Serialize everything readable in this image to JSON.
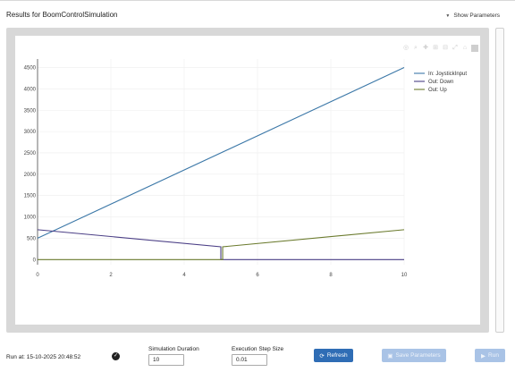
{
  "header": {
    "title": "Results for BoomControlSimulation",
    "show_parameters": "Show Parameters"
  },
  "toolbar_icons": [
    "camera-icon",
    "zoom-icon",
    "pan-icon",
    "zoom-in-icon",
    "zoom-out-icon",
    "autoscale-icon",
    "reset-axes-icon",
    "plotly-logo-icon"
  ],
  "chart_data": {
    "type": "line",
    "x_ticks": [
      "0",
      "2",
      "4",
      "6",
      "8",
      "10"
    ],
    "y_ticks": [
      "0",
      "500",
      "1000",
      "1500",
      "2000",
      "2500",
      "3000",
      "3500",
      "4000",
      "4500"
    ],
    "xlim": [
      0,
      10
    ],
    "ylim": [
      -120,
      4700
    ],
    "grid": true,
    "legend_position": "top-right",
    "series": [
      {
        "name": "In: JoystickInput",
        "color": "#3c78a8",
        "x": [
          0,
          10
        ],
        "y": [
          500,
          4500
        ]
      },
      {
        "name": "Out: Down",
        "color": "#4b3f86",
        "x": [
          0,
          5,
          5,
          5.05,
          10
        ],
        "y": [
          700,
          300,
          0,
          0,
          0
        ]
      },
      {
        "name": "Out: Up",
        "color": "#6b7b2e",
        "x": [
          0,
          5,
          5.05,
          5.05,
          10
        ],
        "y": [
          0,
          0,
          0,
          300,
          700
        ]
      }
    ]
  },
  "footer": {
    "run_at": "Run at: 15-10-2025 20:48:52",
    "duration_label": "Simulation Duration",
    "duration_value": "10",
    "step_label": "Execution Step Size",
    "step_value": "0.01",
    "refresh_label": "Refresh",
    "save_label": "Save Parameters",
    "run_label": "Run"
  }
}
